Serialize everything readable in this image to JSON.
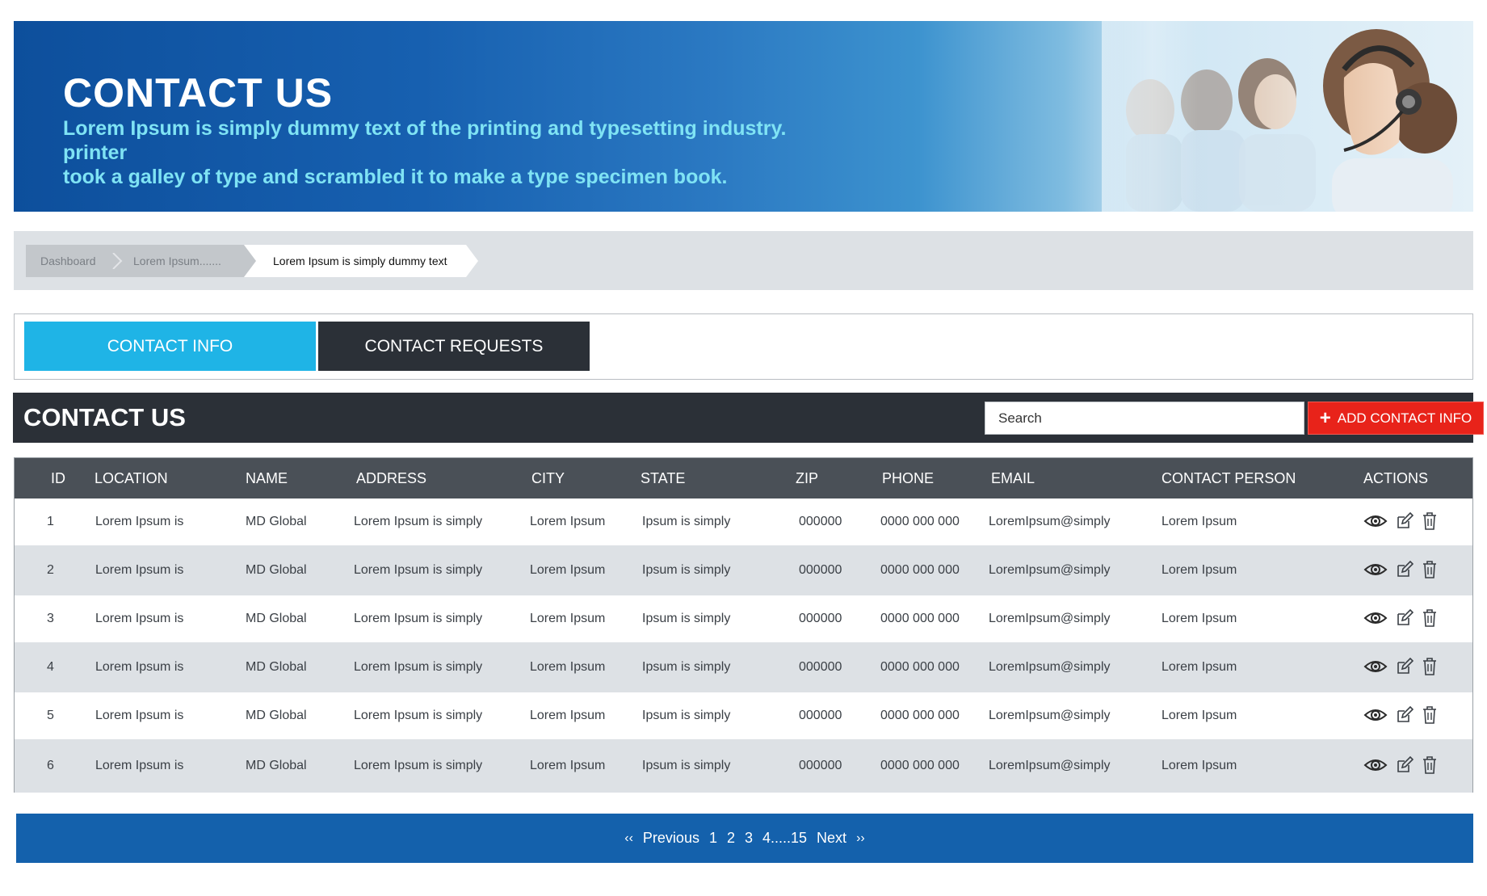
{
  "hero": {
    "title": "CONTACT US",
    "subtitle_line1": "Lorem Ipsum is simply dummy text of the printing and typesetting industry. printer",
    "subtitle_line2": "took a galley of type and scrambled it to make a type specimen book."
  },
  "breadcrumb": {
    "items": [
      "Dashboard",
      "Lorem Ipsum.......",
      "Lorem Ipsum is simply dummy text"
    ]
  },
  "tabs": [
    {
      "label": "CONTACT INFO",
      "active": true
    },
    {
      "label": "CONTACT REQUESTS",
      "active": false
    }
  ],
  "section": {
    "title": "CONTACT US",
    "search_placeholder": "Search",
    "add_label": "ADD CONTACT INFO"
  },
  "table": {
    "headers": [
      "ID",
      "LOCATION",
      "NAME",
      "ADDRESS",
      "CITY",
      "STATE",
      "ZIP",
      "PHONE",
      "EMAIL",
      "CONTACT PERSON",
      "ACTIONS"
    ],
    "rows": [
      [
        "1",
        "Lorem Ipsum is",
        "MD Global",
        "Lorem Ipsum is simply",
        "Lorem Ipsum",
        "Ipsum is simply",
        "000000",
        "0000 000  000",
        "LoremIpsum@simply",
        "Lorem Ipsum"
      ],
      [
        "2",
        "Lorem Ipsum is",
        "MD Global",
        "Lorem Ipsum is simply",
        "Lorem Ipsum",
        "Ipsum is simply",
        "000000",
        "0000 000  000",
        "LoremIpsum@simply",
        "Lorem Ipsum"
      ],
      [
        "3",
        "Lorem Ipsum is",
        "MD Global",
        "Lorem Ipsum is simply",
        "Lorem Ipsum",
        "Ipsum is simply",
        "000000",
        "0000 000  000",
        "LoremIpsum@simply",
        "Lorem Ipsum"
      ],
      [
        "4",
        "Lorem Ipsum is",
        "MD Global",
        "Lorem Ipsum is simply",
        "Lorem Ipsum",
        "Ipsum is simply",
        "000000",
        "0000 000  000",
        "LoremIpsum@simply",
        "Lorem Ipsum"
      ],
      [
        "5",
        "Lorem Ipsum is",
        "MD Global",
        "Lorem Ipsum is simply",
        "Lorem Ipsum",
        "Ipsum is simply",
        "000000",
        "0000 000  000",
        "LoremIpsum@simply",
        "Lorem Ipsum"
      ],
      [
        "6",
        "Lorem Ipsum is",
        "MD Global",
        "Lorem Ipsum is simply",
        "Lorem Ipsum",
        "Ipsum is simply",
        "000000",
        "0000 000  000",
        "LoremIpsum@simply",
        "Lorem Ipsum"
      ]
    ],
    "action_icons": [
      "eye-icon",
      "edit-icon",
      "trash-icon"
    ]
  },
  "pagination": {
    "prev_arrow": "‹‹",
    "prev_label": "Previous",
    "pages": [
      "1",
      "2",
      "3",
      "4.....15"
    ],
    "next_label": "Next",
    "next_arrow": "››"
  },
  "colors": {
    "tab_active": "#1fb4e6",
    "dark_bar": "#2b3037",
    "add_button": "#e8231a",
    "pager": "#1461ac",
    "subtitle": "#7fe3f4"
  }
}
